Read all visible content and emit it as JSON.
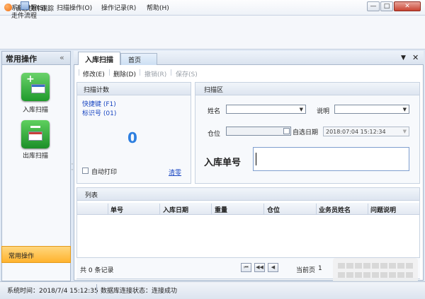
{
  "window": {
    "title": "百思快件跟踪",
    "min": "—",
    "max": "□",
    "close": "✕"
  },
  "menu": [
    "系统设置(S)",
    "扫描操作(O)",
    "操作记录(R)",
    "帮助(H)"
  ],
  "toolbar": {
    "flow_label": "走件流程"
  },
  "sidebar": {
    "title": "常用操作",
    "collapse": "«",
    "items": [
      {
        "label": "入库扫描",
        "icon": "inbound-scan-icon"
      },
      {
        "label": "出库扫描",
        "icon": "outbound-scan-icon"
      }
    ],
    "footer": "常用操作"
  },
  "tabs": [
    {
      "label": "入库扫描",
      "active": true
    },
    {
      "label": "首页",
      "active": false
    }
  ],
  "tab_controls": {
    "menu": "▼",
    "close": "✕"
  },
  "actions": [
    {
      "label": "修改(E)",
      "enabled": true
    },
    {
      "label": "删除(D)",
      "enabled": true
    },
    {
      "label": "撤销(R)",
      "enabled": false
    },
    {
      "label": "保存(S)",
      "enabled": false
    }
  ],
  "scan_count": {
    "title": "扫描计数",
    "hotkey": "快捷键 (F1)",
    "mark": "标识号 (01)",
    "count": "0",
    "auto_print": "自动打印",
    "clear": "清零"
  },
  "scan_area": {
    "title": "扫描区",
    "name_label": "姓名",
    "name_value": "",
    "note_label": "说明",
    "note_value": "",
    "position_label": "仓位",
    "position_value": "",
    "auto_date_label": "自选日期",
    "date_value": "2018:07:04 15:12:34",
    "order_label": "入库单号",
    "order_value": ""
  },
  "list": {
    "title": "列表",
    "columns": [
      "单号",
      "入库日期",
      "重量",
      "仓位",
      "业务员姓名",
      "问题说明"
    ],
    "rows": []
  },
  "pager": {
    "total": "共 0 条记录",
    "page_label": "当前页",
    "page_number": "1",
    "buttons": [
      "⏮",
      "◀◀",
      "◀"
    ]
  },
  "status": {
    "time": "系统时间：2018/7/4 15:12:35",
    "db": "数据库连接状态：连接成功"
  },
  "colors": {
    "accent": "#2d7fe0",
    "link": "#1a47c2",
    "green": "#1f9a2c",
    "orange": "#ffb32e"
  }
}
